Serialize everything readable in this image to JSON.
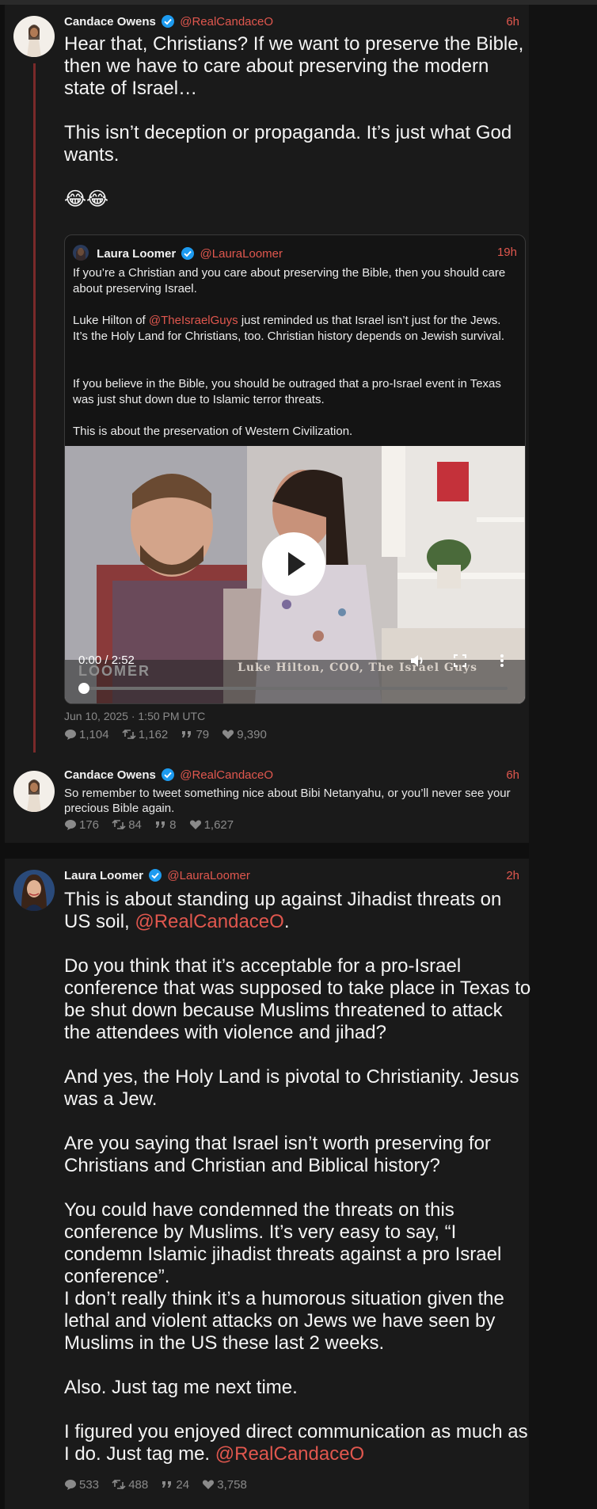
{
  "thread": {
    "tweet1": {
      "name": "Candace Owens",
      "handle": "@RealCandaceO",
      "time": "6h",
      "text": "Hear that, Christians? If we want to preserve the Bible, then we have to care about preserving the modern state of Israel…\n\nThis isn’t deception or propaganda. It’s just what God wants.\n\n😂😂",
      "quote": {
        "name": "Laura Loomer",
        "handle": "@LauraLoomer",
        "time": "19h",
        "p1": "If you’re a Christian and you care about preserving the Bible, then you should care about preserving Israel.",
        "p2_pre": "Luke Hilton of ",
        "p2_mention": "@TheIsraelGuys",
        "p2_post": " just reminded us that Israel isn’t just for the Jews. It’s the Holy Land for Christians, too. Christian history depends on Jewish survival.",
        "p3": "If you believe in the Bible, you should be outraged that a pro-Israel event in Texas was just shut down due to Islamic terror threats.",
        "p4": "This is about the preservation of Western Civilization.",
        "video": {
          "time": "0:00 / 2:52",
          "caption": "Luke Hilton, COO, The Israel Guys",
          "logo": "LOOMER",
          "progress": 0
        }
      },
      "date": "Jun 10, 2025 · 1:50 PM UTC",
      "stats": {
        "replies": "1,104",
        "retweets": "1,162",
        "quotes": "79",
        "likes": "9,390"
      }
    },
    "tweet2": {
      "name": "Candace Owens",
      "handle": "@RealCandaceO",
      "time": "6h",
      "text": "So remember to tweet something nice about Bibi Netanyahu, or you’ll never see your precious Bible again.",
      "stats": {
        "replies": "176",
        "retweets": "84",
        "quotes": "8",
        "likes": "1,627"
      }
    }
  },
  "reply": {
    "name": "Laura Loomer",
    "handle": "@LauraLoomer",
    "time": "2h",
    "p1_pre": "This is about standing up against Jihadist threats on US soil, ",
    "p1_mention": "@RealCandaceO",
    "p1_post": ".",
    "p2": "Do you think that it’s acceptable for a pro-Israel conference that was supposed to take place in Texas to be shut down because Muslims threatened to attack the attendees with violence and jihad?",
    "p3": "And yes, the Holy Land is pivotal to Christianity. Jesus was a Jew.",
    "p4": "Are you saying that Israel isn’t worth preserving for Christians and Christian and Biblical history?",
    "p5": "You could have condemned the threats on this conference by Muslims. It’s very easy to say, “I condemn Islamic jihadist threats against a pro Israel conference”.",
    "p6": "I don’t really think it’s a humorous situation given the lethal and violent attacks on Jews we have seen by Muslims in the US these last 2 weeks.",
    "p7": "Also. Just tag me next time.",
    "p8_pre": "I figured you enjoyed direct communication as much as I do. Just tag me. ",
    "p8_mention": "@RealCandaceO",
    "stats": {
      "replies": "533",
      "retweets": "488",
      "quotes": "24",
      "likes": "3,758"
    }
  },
  "colors": {
    "accent": "#e0574e",
    "verified": "#1d9bf0",
    "background": "#0f0f0f",
    "card": "#1a1a1a",
    "thread_line": "#7a2a2a"
  },
  "icons": [
    "verified-badge-icon",
    "comment-icon",
    "retweet-icon",
    "quote-icon",
    "heart-icon",
    "play-icon",
    "volume-icon",
    "fullscreen-icon",
    "more-vertical-icon"
  ]
}
